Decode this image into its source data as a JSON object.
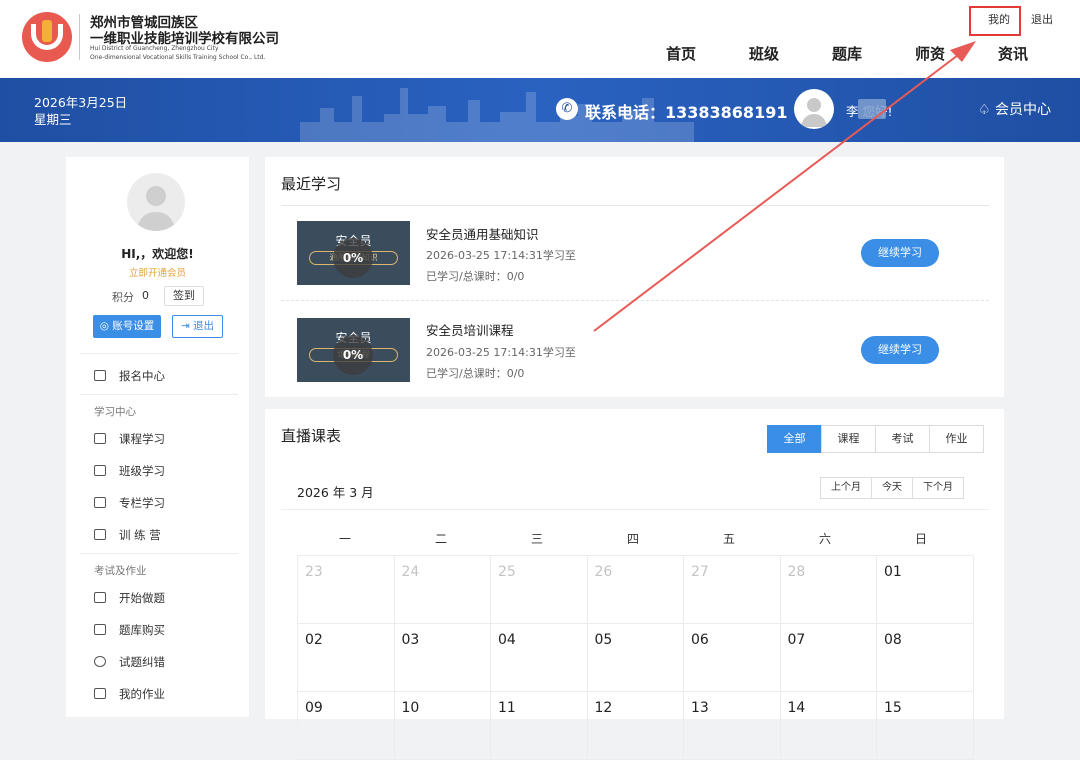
{
  "header": {
    "school_name_line1": "郑州市管城回族区",
    "school_name_line2": "一维职业技能培训学校有限公司",
    "school_name_en1": "Hui District of Guancheng, Zhengzhou City",
    "school_name_en2": "One-dimensional Vocational Skills Training School Co., Ltd.",
    "top_links": {
      "mine": "我的",
      "logout": "退出"
    },
    "nav": [
      "首页",
      "班级",
      "题库",
      "师资",
      "资讯"
    ]
  },
  "banner": {
    "date": "2026年3月25日",
    "weekday": "星期三",
    "phone_label": "联系电话：13383868191",
    "greeting": "李      您好!",
    "member_center": "会员中心"
  },
  "sidebar": {
    "welcome": "HI,，欢迎您!",
    "vip_link": "立即开通会员",
    "points_label": "积分",
    "points_value": "0",
    "sign_in": "签到",
    "account_settings": "账号设置",
    "logout": "退出",
    "item_register": "报名中心",
    "section_study": "学习中心",
    "item_course": "课程学习",
    "item_class": "班级学习",
    "item_column": "专栏学习",
    "item_camp": "训 练 营",
    "section_exam": "考试及作业",
    "item_practice": "开始做题",
    "item_buy_bank": "题库购买",
    "item_mistakes": "试题纠错",
    "item_homework": "我的作业"
  },
  "recent": {
    "title": "最近学习",
    "courses": [
      {
        "thumb_title": "安全员",
        "thumb_sub": "通用基础知识",
        "progress": "0%",
        "name": "安全员通用基础知识",
        "date": "2026-03-25 17:14:31学习至",
        "hours": "已学习/总课时：0/0",
        "button": "继续学习"
      },
      {
        "thumb_title": "安全员",
        "thumb_sub": "培训课程",
        "progress": "0%",
        "name": "安全员培训课程",
        "date": "2026-03-25 17:14:31学习至",
        "hours": "已学习/总课时：0/0",
        "button": "继续学习"
      }
    ]
  },
  "live": {
    "title": "直播课表",
    "tabs": [
      "全部",
      "课程",
      "考试",
      "作业"
    ],
    "active_tab": "全部",
    "year_month": "2026 年 3 月",
    "month_nav": [
      "上个月",
      "今天",
      "下个月"
    ],
    "weekdays": [
      "一",
      "二",
      "三",
      "四",
      "五",
      "六",
      "日"
    ],
    "days_row1": [
      "23",
      "24",
      "25",
      "26",
      "27",
      "28",
      "01"
    ],
    "days_row2": [
      "02",
      "03",
      "04",
      "05",
      "06",
      "07",
      "08"
    ],
    "days_row3": [
      "09",
      "10",
      "11",
      "12",
      "13",
      "14",
      "15"
    ]
  },
  "colors": {
    "brand_blue": "#1f4fa3",
    "accent": "#3a8ee6",
    "highlight": "#e53935"
  }
}
